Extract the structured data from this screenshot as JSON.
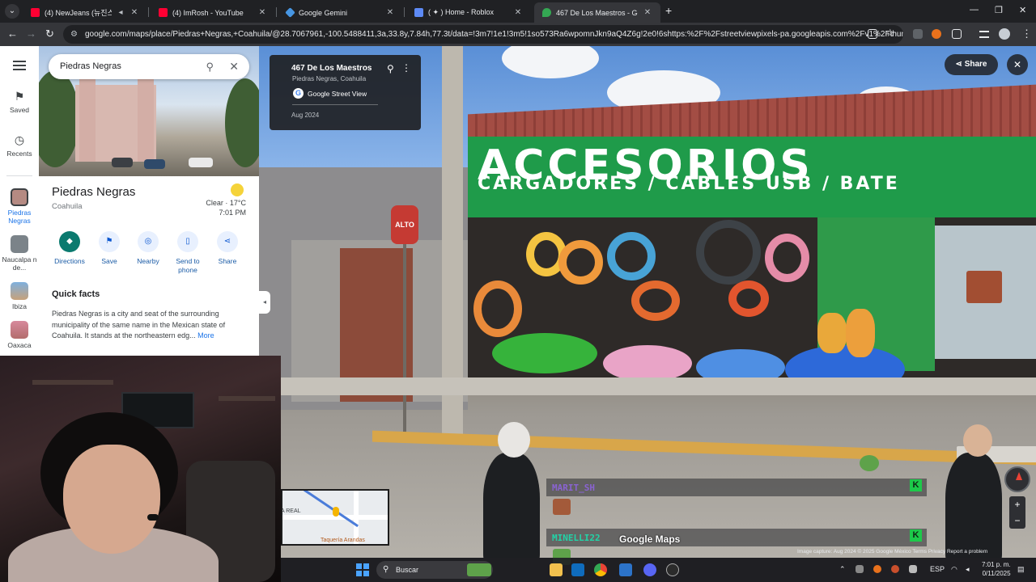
{
  "browser": {
    "tabs": [
      {
        "label": "(4) NewJeans (뉴진스) 'Supe",
        "favicon_color": "#ff0033"
      },
      {
        "label": "(4) ImRosh - YouTube",
        "favicon_color": "#ff0033"
      },
      {
        "label": "Google Gemini",
        "favicon_color": "#4796e3"
      },
      {
        "label": "( ✦ ) Home - Roblox",
        "favicon_color": "#5d8af5"
      },
      {
        "label": "467 De Los Maestros - Google",
        "favicon_color": "#34a853"
      }
    ],
    "active_tab_index": 4,
    "url": "google.com/maps/place/Piedras+Negras,+Coahuila/@28.7067961,-100.5488411,3a,33.8y,7.84h,77.3t/data=!3m7!1e1!3m5!1so573Ra6wpomnJkn9aQ4Z6g!2e0!6shttps:%2F%2Fstreetviewpixels-pa.googleapis.com%2Fv1%2Fthumbnail..."
  },
  "maps": {
    "search": {
      "value": "Piedras Negras"
    },
    "rail": {
      "saved": "Saved",
      "recents": "Recents",
      "history": [
        "Piedras Negras",
        "Naucalpa n de...",
        "Ibiza",
        "Oaxaca"
      ]
    },
    "place": {
      "name": "Piedras Negras",
      "region": "Coahuila",
      "weather": "Clear · 17°C",
      "time": "7:01 PM"
    },
    "actions": {
      "directions": "Directions",
      "save": "Save",
      "nearby": "Nearby",
      "send_to_phone": "Send to phone",
      "share": "Share"
    },
    "quick_facts": {
      "title": "Quick facts",
      "text": "Piedras Negras is a city and seat of the surrounding municipality of the same name in the Mexican state of Coahuila. It stands at the northeastern edg...",
      "more": "More"
    }
  },
  "streetview": {
    "card": {
      "address": "467 De Los Maestros",
      "city": "Piedras Negras, Coahuila",
      "source": "Google Street View",
      "date": "Aug 2024"
    },
    "share": "Share",
    "sign_text_1": "ACCESORIOS",
    "sign_text_2": "CARGADORES / CABLES USB / BATE",
    "stop_sign": "ALTO",
    "logo": "Google Maps",
    "attribution": "Image capture: Aug 2024   © 2025 Google   México   Terms   Privacy   Report a problem"
  },
  "stream_chat": {
    "messages": [
      {
        "user": "MARIT_SH",
        "color": "#8a63d2"
      },
      {
        "user": "MINELLI22",
        "color": "#22d3a7"
      }
    ]
  },
  "minimap": {
    "label_1": "A REAL",
    "label_2": "Taquería Arandas"
  },
  "taskbar": {
    "search": "Buscar",
    "lang": "ESP",
    "time": "7:01 p. m.",
    "date": "0/11/2025"
  }
}
